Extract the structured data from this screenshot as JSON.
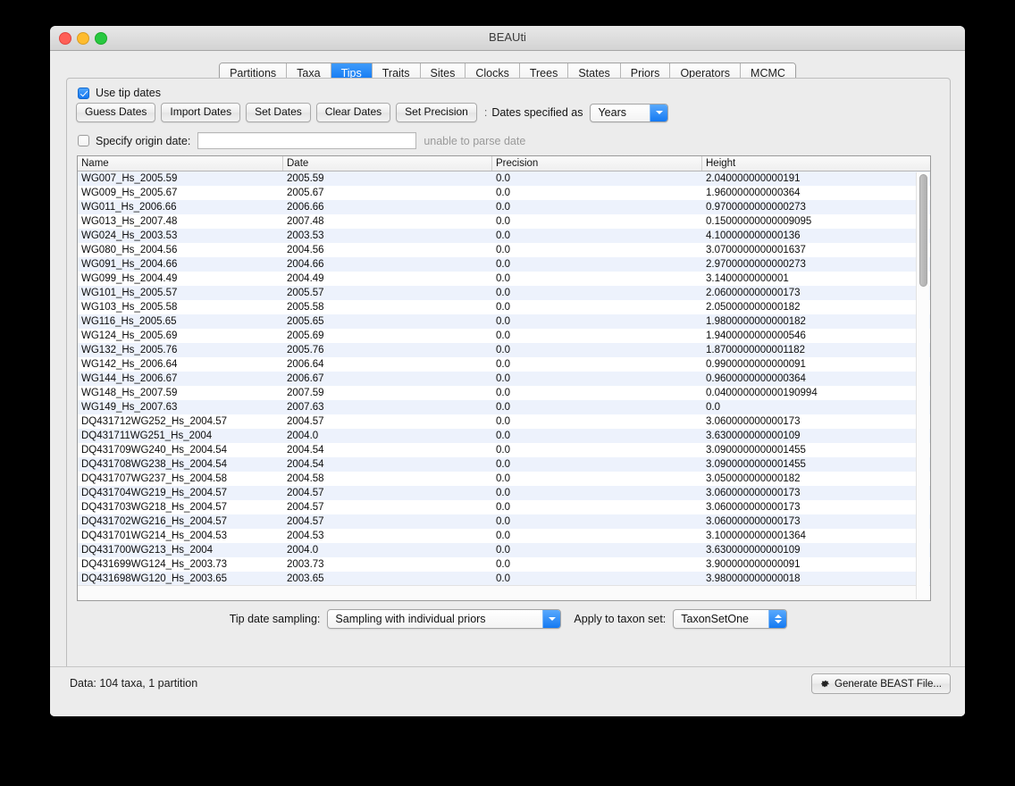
{
  "window": {
    "title": "BEAUti",
    "traffic_lights": [
      "close",
      "minimize",
      "maximize"
    ]
  },
  "tabs": [
    {
      "label": "Partitions",
      "active": false
    },
    {
      "label": "Taxa",
      "active": false
    },
    {
      "label": "Tips",
      "active": true
    },
    {
      "label": "Traits",
      "active": false
    },
    {
      "label": "Sites",
      "active": false
    },
    {
      "label": "Clocks",
      "active": false
    },
    {
      "label": "Trees",
      "active": false
    },
    {
      "label": "States",
      "active": false
    },
    {
      "label": "Priors",
      "active": false
    },
    {
      "label": "Operators",
      "active": false
    },
    {
      "label": "MCMC",
      "active": false
    }
  ],
  "options": {
    "use_tip_dates_label": "Use tip dates",
    "use_tip_dates_checked": true,
    "buttons": [
      "Guess Dates",
      "Import Dates",
      "Set Dates",
      "Clear Dates",
      "Set Precision"
    ],
    "dates_specified_as_label": "Dates specified as",
    "dates_unit_value": "Years",
    "specify_origin_date_label": "Specify origin date:",
    "specify_origin_date_checked": false,
    "origin_date_value": "",
    "origin_date_placeholder": "",
    "parse_error_text": "unable to parse date"
  },
  "table": {
    "columns": [
      "Name",
      "Date",
      "Precision",
      "Height"
    ],
    "rows": [
      [
        "WG007_Hs_2005.59",
        "2005.59",
        "0.0",
        "2.040000000000191"
      ],
      [
        "WG009_Hs_2005.67",
        "2005.67",
        "0.0",
        "1.960000000000364"
      ],
      [
        "WG011_Hs_2006.66",
        "2006.66",
        "0.0",
        "0.9700000000000273"
      ],
      [
        "WG013_Hs_2007.48",
        "2007.48",
        "0.0",
        "0.15000000000009095"
      ],
      [
        "WG024_Hs_2003.53",
        "2003.53",
        "0.0",
        "4.100000000000136"
      ],
      [
        "WG080_Hs_2004.56",
        "2004.56",
        "0.0",
        "3.0700000000001637"
      ],
      [
        "WG091_Hs_2004.66",
        "2004.66",
        "0.0",
        "2.9700000000000273"
      ],
      [
        "WG099_Hs_2004.49",
        "2004.49",
        "0.0",
        "3.1400000000001"
      ],
      [
        "WG101_Hs_2005.57",
        "2005.57",
        "0.0",
        "2.060000000000173"
      ],
      [
        "WG103_Hs_2005.58",
        "2005.58",
        "0.0",
        "2.050000000000182"
      ],
      [
        "WG116_Hs_2005.65",
        "2005.65",
        "0.0",
        "1.9800000000000182"
      ],
      [
        "WG124_Hs_2005.69",
        "2005.69",
        "0.0",
        "1.9400000000000546"
      ],
      [
        "WG132_Hs_2005.76",
        "2005.76",
        "0.0",
        "1.8700000000001182"
      ],
      [
        "WG142_Hs_2006.64",
        "2006.64",
        "0.0",
        "0.9900000000000091"
      ],
      [
        "WG144_Hs_2006.67",
        "2006.67",
        "0.0",
        "0.9600000000000364"
      ],
      [
        "WG148_Hs_2007.59",
        "2007.59",
        "0.0",
        "0.040000000000190994"
      ],
      [
        "WG149_Hs_2007.63",
        "2007.63",
        "0.0",
        "0.0"
      ],
      [
        "DQ431712WG252_Hs_2004.57",
        "2004.57",
        "0.0",
        "3.060000000000173"
      ],
      [
        "DQ431711WG251_Hs_2004",
        "2004.0",
        "0.0",
        "3.630000000000109"
      ],
      [
        "DQ431709WG240_Hs_2004.54",
        "2004.54",
        "0.0",
        "3.0900000000001455"
      ],
      [
        "DQ431708WG238_Hs_2004.54",
        "2004.54",
        "0.0",
        "3.0900000000001455"
      ],
      [
        "DQ431707WG237_Hs_2004.58",
        "2004.58",
        "0.0",
        "3.050000000000182"
      ],
      [
        "DQ431704WG219_Hs_2004.57",
        "2004.57",
        "0.0",
        "3.060000000000173"
      ],
      [
        "DQ431703WG218_Hs_2004.57",
        "2004.57",
        "0.0",
        "3.060000000000173"
      ],
      [
        "DQ431702WG216_Hs_2004.57",
        "2004.57",
        "0.0",
        "3.060000000000173"
      ],
      [
        "DQ431701WG214_Hs_2004.53",
        "2004.53",
        "0.0",
        "3.1000000000001364"
      ],
      [
        "DQ431700WG213_Hs_2004",
        "2004.0",
        "0.0",
        "3.630000000000109"
      ],
      [
        "DQ431699WG124_Hs_2003.73",
        "2003.73",
        "0.0",
        "3.900000000000091"
      ],
      [
        "DQ431698WG120_Hs_2003.65",
        "2003.65",
        "0.0",
        "3.980000000000018"
      ]
    ]
  },
  "bottom": {
    "tip_date_sampling_label": "Tip date sampling:",
    "tip_date_sampling_value": "Sampling with individual priors",
    "apply_to_taxon_set_label": "Apply to taxon set:",
    "apply_to_taxon_set_value": "TaxonSetOne"
  },
  "footer": {
    "status": "Data: 104 taxa, 1 partition",
    "generate_button_label": "Generate BEAST File..."
  },
  "colors": {
    "accent_blue": "#0a73f1",
    "row_stripe": "#edf2fc",
    "window_bg": "#ececec",
    "desktop_bg": "#000000"
  }
}
